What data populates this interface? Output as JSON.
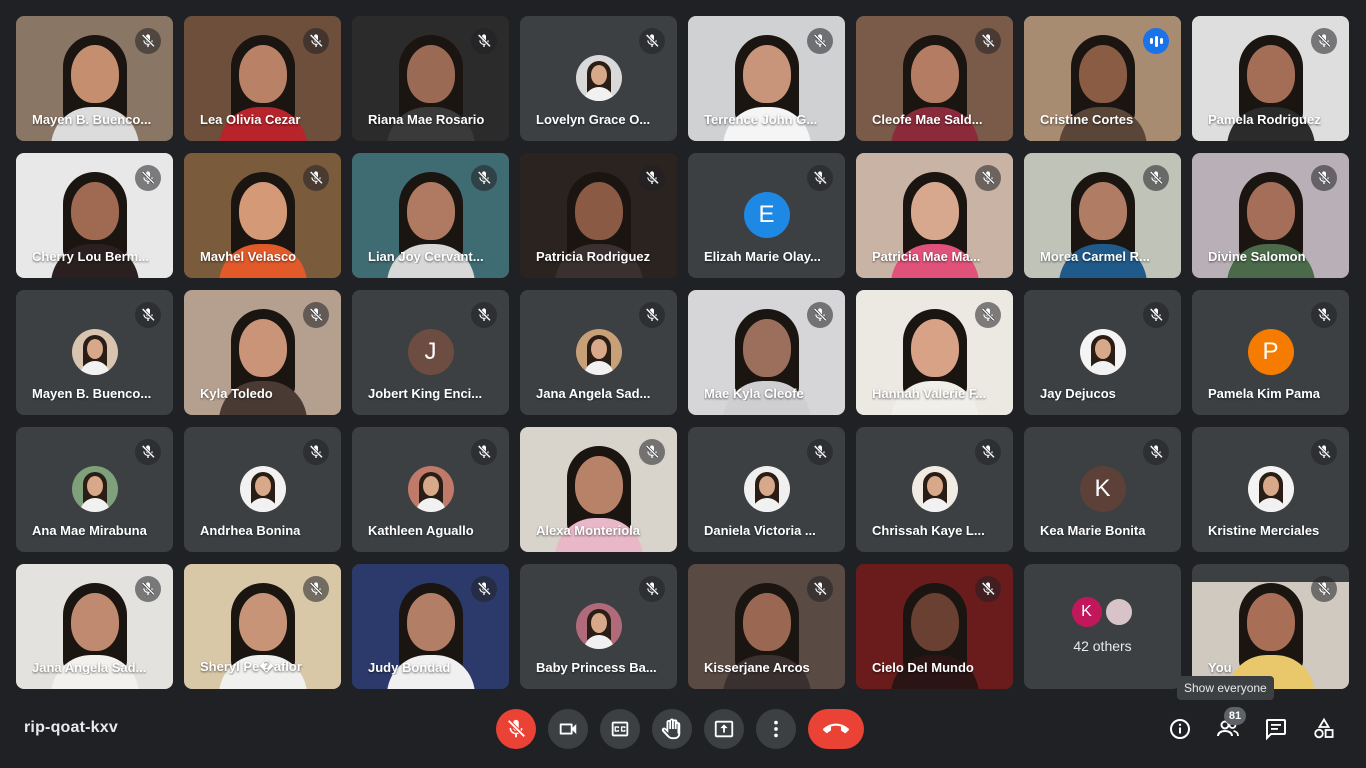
{
  "participants": [
    {
      "name": "Mayen B. Buenco...",
      "type": "video",
      "bg": "#8a7664",
      "skin": "#c58e6e",
      "shirt": "#dcdcdc",
      "muted": true
    },
    {
      "name": "Lea Olivia Cezar",
      "type": "video",
      "bg": "#6d4f3b",
      "skin": "#b98266",
      "shirt": "#b8242b",
      "muted": true
    },
    {
      "name": "Riana Mae Rosario",
      "type": "video",
      "bg": "#2c2b2b",
      "skin": "#9a6a54",
      "shirt": "#3a3a3a",
      "muted": true
    },
    {
      "name": "Lovelyn Grace O...",
      "type": "photo",
      "avatar_bg": "#d9d9d9",
      "muted": true
    },
    {
      "name": "Terrence John G...",
      "type": "video",
      "bg": "#cfd1d3",
      "skin": "#c8957a",
      "shirt": "#f5f5f5",
      "muted": true
    },
    {
      "name": "Cleofe Mae Sald...",
      "type": "video",
      "bg": "#7a5a48",
      "skin": "#b47c62",
      "shirt": "#8a2a3a",
      "muted": true
    },
    {
      "name": "Cristine Cortes",
      "type": "video",
      "bg": "#a88c72",
      "skin": "#8a5c44",
      "shirt": "#5a4638",
      "muted": false,
      "speaking": true
    },
    {
      "name": "Pamela Rodriguez",
      "type": "video",
      "bg": "#dedede",
      "skin": "#a46e56",
      "shirt": "#2b2b2b",
      "muted": true
    },
    {
      "name": "Cherry Lou Berm...",
      "type": "video",
      "bg": "#e8e8e8",
      "skin": "#a06a52",
      "shirt": "#2a2020",
      "muted": true
    },
    {
      "name": "Mavhel Velasco",
      "type": "video",
      "bg": "#7a5c3c",
      "skin": "#d49a78",
      "shirt": "#e25a2a",
      "muted": true
    },
    {
      "name": "Lian Joy Cervant...",
      "type": "video",
      "bg": "#3f6b72",
      "skin": "#b07a62",
      "shirt": "#d8d8d8",
      "muted": true
    },
    {
      "name": "Patricia Rodriguez",
      "type": "video",
      "bg": "#2a2320",
      "skin": "#8a5a44",
      "shirt": "#3a3030",
      "muted": true
    },
    {
      "name": "Elizah Marie Olay...",
      "type": "initial",
      "initial": "E",
      "avatar_bg": "#1e88e5",
      "muted": true
    },
    {
      "name": "Patricia Mae Ma...",
      "type": "video",
      "bg": "#c9b3a4",
      "skin": "#d8a88e",
      "shirt": "#e0527a",
      "muted": true
    },
    {
      "name": "Morea Carmel R...",
      "type": "video",
      "bg": "#bfc3b8",
      "skin": "#b07c64",
      "shirt": "#1f5a8a",
      "muted": true
    },
    {
      "name": "Divine Salomon",
      "type": "video",
      "bg": "#b8b0b6",
      "skin": "#a46e58",
      "shirt": "#4a6a4a",
      "muted": true
    },
    {
      "name": "Mayen B. Buenco...",
      "type": "photo",
      "avatar_bg": "#d9c4b0",
      "muted": true
    },
    {
      "name": "Kyla Toledo",
      "type": "video",
      "bg": "#b5a090",
      "skin": "#c99478",
      "shirt": "#4a3a34",
      "muted": true
    },
    {
      "name": "Jobert King Enci...",
      "type": "initial",
      "initial": "J",
      "avatar_bg": "#6d4c41",
      "muted": true
    },
    {
      "name": "Jana Angela Sad...",
      "type": "photo",
      "avatar_bg": "#c8a078",
      "muted": true
    },
    {
      "name": "Mae Kyla Cleofe",
      "type": "video",
      "bg": "#d6d6d8",
      "skin": "#9b6f5c",
      "shirt": "#cfcfd2",
      "muted": true
    },
    {
      "name": "Hannah Valerie F...",
      "type": "video",
      "bg": "#ece8e2",
      "skin": "#d7a286",
      "shirt": "#f1efe9",
      "muted": true
    },
    {
      "name": "Jay Dejucos",
      "type": "photo",
      "avatar_bg": "#f4f4f4",
      "muted": true
    },
    {
      "name": "Pamela Kim Pama",
      "type": "initial",
      "initial": "P",
      "avatar_bg": "#f57c00",
      "muted": true
    },
    {
      "name": "Ana Mae Mirabuna",
      "type": "photo",
      "avatar_bg": "#7ea07a",
      "muted": true
    },
    {
      "name": "Andrhea Bonina",
      "type": "photo",
      "avatar_bg": "#f2f2f2",
      "muted": true
    },
    {
      "name": "Kathleen Aguallo",
      "type": "photo",
      "avatar_bg": "#c07a6a",
      "muted": true
    },
    {
      "name": "Alexa Monteriola",
      "type": "video",
      "bg": "#d8d4cc",
      "skin": "#b88268",
      "shirt": "#e8b8c8",
      "muted": true
    },
    {
      "name": "Daniela Victoria ...",
      "type": "photo",
      "avatar_bg": "#f0f0f0",
      "muted": true
    },
    {
      "name": "Chrissah Kaye L...",
      "type": "photo",
      "avatar_bg": "#f2ebe4",
      "muted": true
    },
    {
      "name": "Kea Marie Bonita",
      "type": "initial",
      "initial": "K",
      "avatar_bg": "#5d4037",
      "muted": true
    },
    {
      "name": "Kristine Merciales",
      "type": "photo",
      "avatar_bg": "#f3f3f3",
      "muted": true
    },
    {
      "name": "Jana Angela Sad...",
      "type": "video",
      "bg": "#e4e2de",
      "skin": "#c08a70",
      "shirt": "#f3f1ee",
      "muted": true
    },
    {
      "name": "Sheryl Pe�aflor",
      "type": "video",
      "bg": "#d8c8a8",
      "skin": "#c89478",
      "shirt": "#f0f0ee",
      "muted": true
    },
    {
      "name": "Judy Bondad",
      "type": "video",
      "bg": "#2b3a6a",
      "skin": "#b27e66",
      "shirt": "#f0f0f0",
      "muted": true
    },
    {
      "name": "Baby Princess Ba...",
      "type": "photo",
      "avatar_bg": "#b06a7a",
      "muted": true
    },
    {
      "name": "Kisserjane Arcos",
      "type": "video",
      "bg": "#5a4a44",
      "skin": "#9a6852",
      "shirt": "#3a3030",
      "muted": true
    },
    {
      "name": "Cielo Del Mundo",
      "type": "video",
      "bg": "#6a1c1c",
      "skin": "#6a4032",
      "shirt": "#2a1414",
      "muted": true
    },
    {
      "name": "42 others",
      "type": "others",
      "others_initial": "K",
      "others_bg": "#c2185b"
    },
    {
      "name": "You",
      "type": "self",
      "bg": "#cfc9c0",
      "skin": "#a86e56",
      "shirt": "#e8c86a",
      "muted": true
    }
  ],
  "meeting": {
    "code": "rip-qoat-kxv",
    "participant_count": "81",
    "tooltip": "Show everyone"
  },
  "controls": {
    "mic": "mic-off-icon",
    "camera": "camera-icon",
    "captions": "captions-icon",
    "hand": "raise-hand-icon",
    "present": "present-icon",
    "more": "more-options-icon",
    "end": "end-call-icon"
  },
  "colors": {
    "background": "#202124",
    "tile": "#3c4043",
    "accent": "#8ab4f8",
    "danger": "#ea4335"
  }
}
